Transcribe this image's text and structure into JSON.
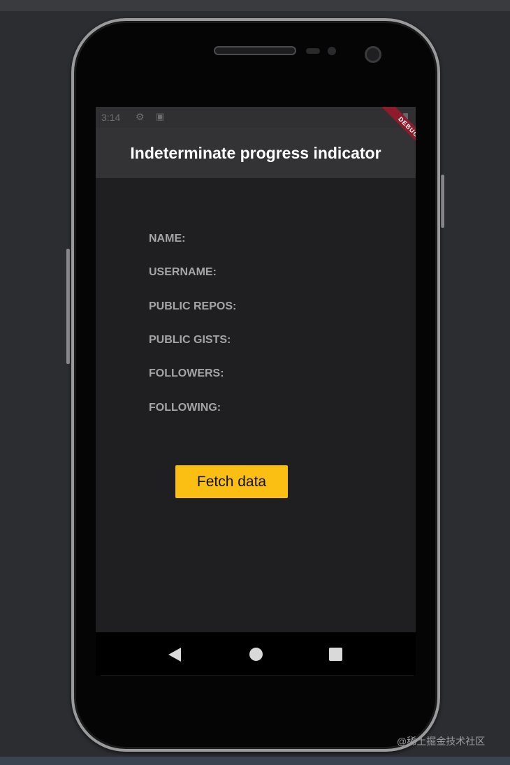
{
  "status_bar": {
    "time": "3:14",
    "gear_icon": "gear-icon",
    "sim_icon": "sim-card-icon",
    "battery_icon": "battery-icon"
  },
  "debug_banner": {
    "text": "DEBUG",
    "color": "#8e1b2c"
  },
  "app_bar": {
    "title": "Indeterminate progress indicator"
  },
  "fields": [
    {
      "label": "NAME:"
    },
    {
      "label": "USERNAME:"
    },
    {
      "label": "PUBLIC REPOS:"
    },
    {
      "label": "PUBLIC GISTS:"
    },
    {
      "label": "FOLLOWERS:"
    },
    {
      "label": "FOLLOWING:"
    }
  ],
  "actions": {
    "fetch_label": "Fetch data",
    "accent": "#fbbf14"
  },
  "nav_bar": {
    "back_icon": "back-triangle-icon",
    "home_icon": "home-circle-icon",
    "recents_icon": "recents-square-icon"
  },
  "watermark": {
    "text": "@稀土掘金技术社区"
  }
}
